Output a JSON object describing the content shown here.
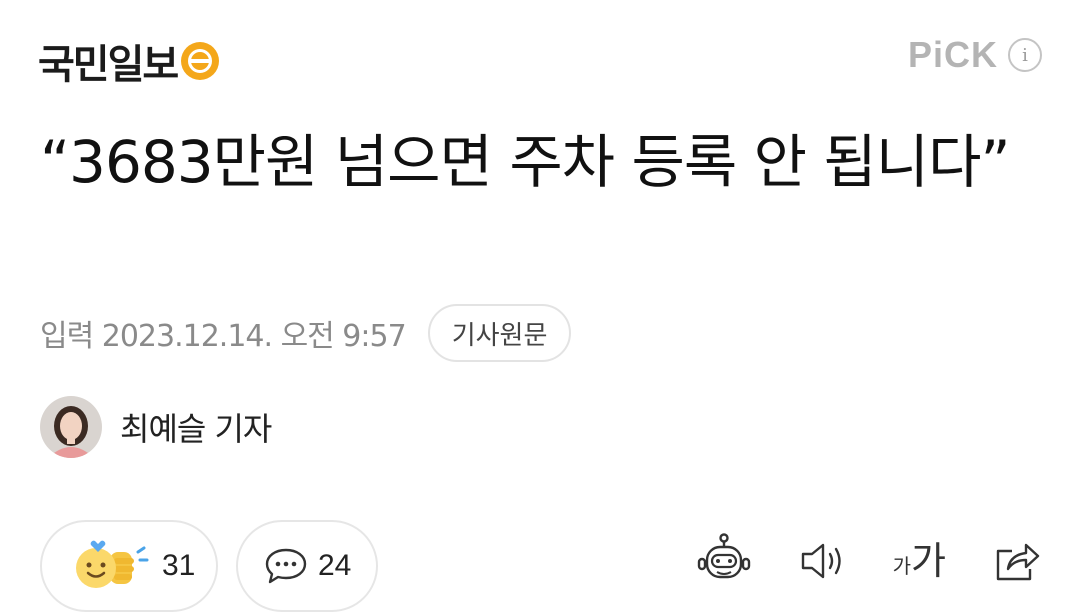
{
  "header": {
    "publisher": "국민일보",
    "pick_label": "PiCK",
    "info_icon": "info-icon"
  },
  "article": {
    "title": "“3683만원 넘으면 주차 등록 안 됩니다”",
    "published": "입력 2023.12.14. 오전 9:57",
    "source_button": "기사원문",
    "reporter": "최예슬 기자"
  },
  "actions": {
    "reaction_count": "31",
    "comment_count": "24",
    "icons": [
      "reaction-icon",
      "comment-icon",
      "summary-bot-icon",
      "speaker-icon",
      "font-size-icon",
      "share-icon"
    ],
    "font_size_small": "가",
    "font_size_large": "가"
  },
  "colors": {
    "logo_accent": "#f4a71a",
    "pick_gray": "#b4b4b4",
    "meta_gray": "#8a8a8a",
    "border_gray": "#e3e3e3"
  }
}
